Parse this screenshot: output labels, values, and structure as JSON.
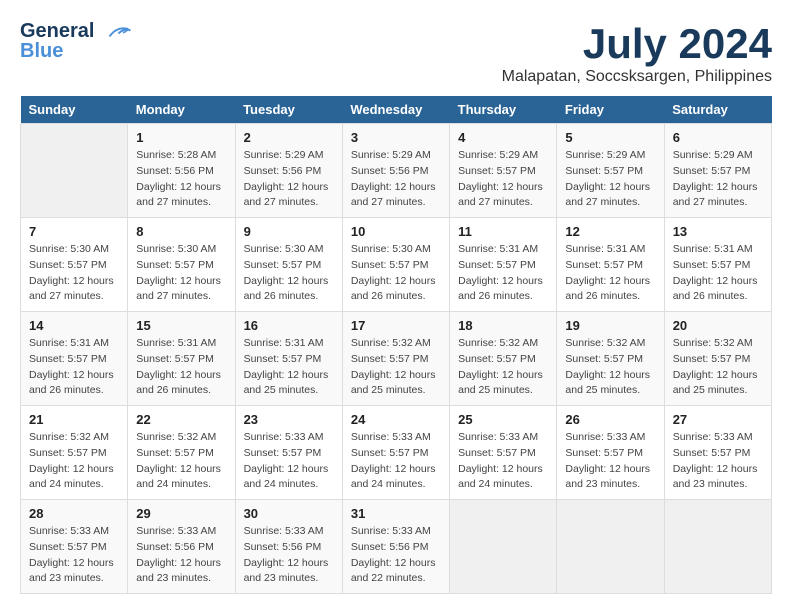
{
  "logo": {
    "line1": "General",
    "line2": "Blue"
  },
  "title": "July 2024",
  "subtitle": "Malapatan, Soccsksargen, Philippines",
  "days_header": [
    "Sunday",
    "Monday",
    "Tuesday",
    "Wednesday",
    "Thursday",
    "Friday",
    "Saturday"
  ],
  "weeks": [
    [
      {
        "day": "",
        "info": ""
      },
      {
        "day": "1",
        "info": "Sunrise: 5:28 AM\nSunset: 5:56 PM\nDaylight: 12 hours\nand 27 minutes."
      },
      {
        "day": "2",
        "info": "Sunrise: 5:29 AM\nSunset: 5:56 PM\nDaylight: 12 hours\nand 27 minutes."
      },
      {
        "day": "3",
        "info": "Sunrise: 5:29 AM\nSunset: 5:56 PM\nDaylight: 12 hours\nand 27 minutes."
      },
      {
        "day": "4",
        "info": "Sunrise: 5:29 AM\nSunset: 5:57 PM\nDaylight: 12 hours\nand 27 minutes."
      },
      {
        "day": "5",
        "info": "Sunrise: 5:29 AM\nSunset: 5:57 PM\nDaylight: 12 hours\nand 27 minutes."
      },
      {
        "day": "6",
        "info": "Sunrise: 5:29 AM\nSunset: 5:57 PM\nDaylight: 12 hours\nand 27 minutes."
      }
    ],
    [
      {
        "day": "7",
        "info": "Sunrise: 5:30 AM\nSunset: 5:57 PM\nDaylight: 12 hours\nand 27 minutes."
      },
      {
        "day": "8",
        "info": "Sunrise: 5:30 AM\nSunset: 5:57 PM\nDaylight: 12 hours\nand 27 minutes."
      },
      {
        "day": "9",
        "info": "Sunrise: 5:30 AM\nSunset: 5:57 PM\nDaylight: 12 hours\nand 26 minutes."
      },
      {
        "day": "10",
        "info": "Sunrise: 5:30 AM\nSunset: 5:57 PM\nDaylight: 12 hours\nand 26 minutes."
      },
      {
        "day": "11",
        "info": "Sunrise: 5:31 AM\nSunset: 5:57 PM\nDaylight: 12 hours\nand 26 minutes."
      },
      {
        "day": "12",
        "info": "Sunrise: 5:31 AM\nSunset: 5:57 PM\nDaylight: 12 hours\nand 26 minutes."
      },
      {
        "day": "13",
        "info": "Sunrise: 5:31 AM\nSunset: 5:57 PM\nDaylight: 12 hours\nand 26 minutes."
      }
    ],
    [
      {
        "day": "14",
        "info": "Sunrise: 5:31 AM\nSunset: 5:57 PM\nDaylight: 12 hours\nand 26 minutes."
      },
      {
        "day": "15",
        "info": "Sunrise: 5:31 AM\nSunset: 5:57 PM\nDaylight: 12 hours\nand 26 minutes."
      },
      {
        "day": "16",
        "info": "Sunrise: 5:31 AM\nSunset: 5:57 PM\nDaylight: 12 hours\nand 25 minutes."
      },
      {
        "day": "17",
        "info": "Sunrise: 5:32 AM\nSunset: 5:57 PM\nDaylight: 12 hours\nand 25 minutes."
      },
      {
        "day": "18",
        "info": "Sunrise: 5:32 AM\nSunset: 5:57 PM\nDaylight: 12 hours\nand 25 minutes."
      },
      {
        "day": "19",
        "info": "Sunrise: 5:32 AM\nSunset: 5:57 PM\nDaylight: 12 hours\nand 25 minutes."
      },
      {
        "day": "20",
        "info": "Sunrise: 5:32 AM\nSunset: 5:57 PM\nDaylight: 12 hours\nand 25 minutes."
      }
    ],
    [
      {
        "day": "21",
        "info": "Sunrise: 5:32 AM\nSunset: 5:57 PM\nDaylight: 12 hours\nand 24 minutes."
      },
      {
        "day": "22",
        "info": "Sunrise: 5:32 AM\nSunset: 5:57 PM\nDaylight: 12 hours\nand 24 minutes."
      },
      {
        "day": "23",
        "info": "Sunrise: 5:33 AM\nSunset: 5:57 PM\nDaylight: 12 hours\nand 24 minutes."
      },
      {
        "day": "24",
        "info": "Sunrise: 5:33 AM\nSunset: 5:57 PM\nDaylight: 12 hours\nand 24 minutes."
      },
      {
        "day": "25",
        "info": "Sunrise: 5:33 AM\nSunset: 5:57 PM\nDaylight: 12 hours\nand 24 minutes."
      },
      {
        "day": "26",
        "info": "Sunrise: 5:33 AM\nSunset: 5:57 PM\nDaylight: 12 hours\nand 23 minutes."
      },
      {
        "day": "27",
        "info": "Sunrise: 5:33 AM\nSunset: 5:57 PM\nDaylight: 12 hours\nand 23 minutes."
      }
    ],
    [
      {
        "day": "28",
        "info": "Sunrise: 5:33 AM\nSunset: 5:57 PM\nDaylight: 12 hours\nand 23 minutes."
      },
      {
        "day": "29",
        "info": "Sunrise: 5:33 AM\nSunset: 5:56 PM\nDaylight: 12 hours\nand 23 minutes."
      },
      {
        "day": "30",
        "info": "Sunrise: 5:33 AM\nSunset: 5:56 PM\nDaylight: 12 hours\nand 23 minutes."
      },
      {
        "day": "31",
        "info": "Sunrise: 5:33 AM\nSunset: 5:56 PM\nDaylight: 12 hours\nand 22 minutes."
      },
      {
        "day": "",
        "info": ""
      },
      {
        "day": "",
        "info": ""
      },
      {
        "day": "",
        "info": ""
      }
    ]
  ]
}
